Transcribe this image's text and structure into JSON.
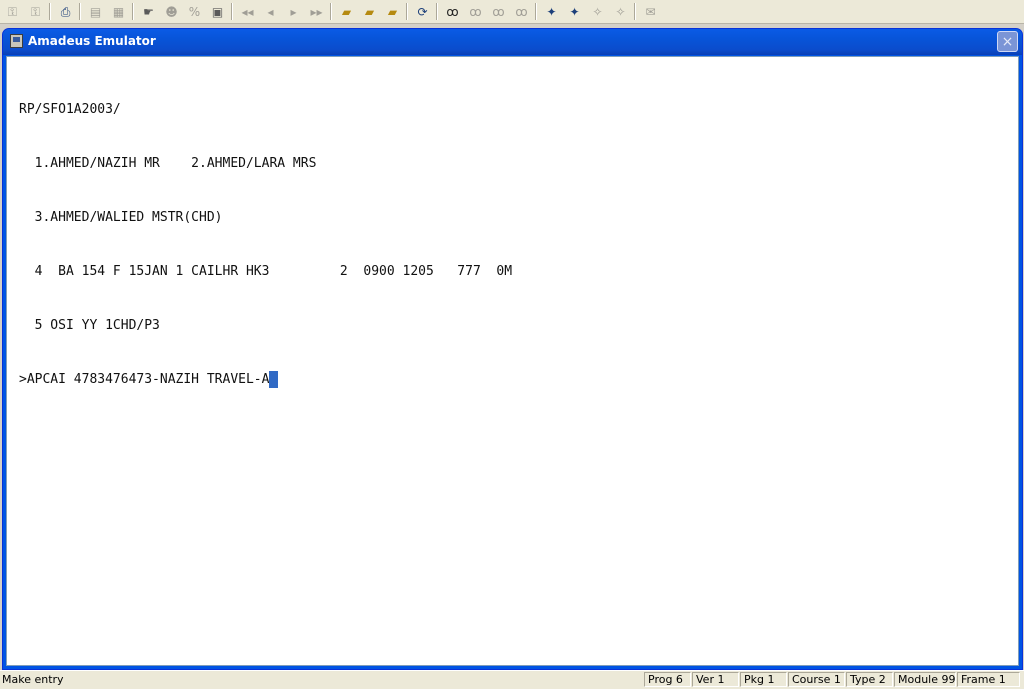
{
  "toolbar": {
    "buttons": [
      {
        "icon": "key-icon"
      },
      {
        "icon": "key-icon"
      },
      {
        "icon": "printer-icon"
      },
      {
        "icon": "grid-icon"
      },
      {
        "icon": "grid-icon"
      },
      {
        "icon": "hand-icon"
      },
      {
        "icon": "user-icon"
      },
      {
        "icon": "percent-icon"
      },
      {
        "icon": "book-icon"
      },
      {
        "icon": "first-icon"
      },
      {
        "icon": "prev-icon"
      },
      {
        "icon": "next-icon"
      },
      {
        "icon": "last-icon"
      },
      {
        "icon": "folder-open-icon"
      },
      {
        "icon": "folder-open-icon"
      },
      {
        "icon": "folder-open-icon"
      },
      {
        "icon": "refresh-icon"
      },
      {
        "icon": "binoculars-icon"
      },
      {
        "icon": "find-icon"
      },
      {
        "icon": "find-icon"
      },
      {
        "icon": "find-icon"
      },
      {
        "icon": "wand-icon"
      },
      {
        "icon": "wand-icon"
      },
      {
        "icon": "tool-icon"
      },
      {
        "icon": "tool-icon"
      },
      {
        "icon": "mail-icon"
      }
    ]
  },
  "window": {
    "title": "Amadeus Emulator",
    "close_label": "×"
  },
  "terminal": {
    "lines": [
      "RP/SFO1A2003/",
      "  1.AHMED/NAZIH MR    2.AHMED/LARA MRS",
      "  3.AHMED/WALIED MSTR(CHD)",
      "  4  BA 154 F 15JAN 1 CAILHR HK3         2  0900 1205   777  0M",
      "  5 OSI YY 1CHD/P3"
    ],
    "input": ">APCAI 4783476473-NAZIH TRAVEL-A"
  },
  "statusbar": {
    "message": "Make entry",
    "prog": "Prog 6",
    "ver": "Ver 1",
    "pkg": "Pkg 1",
    "course": "Course 1",
    "type": "Type 2",
    "module": "Module 99",
    "frame": "Frame 1"
  }
}
